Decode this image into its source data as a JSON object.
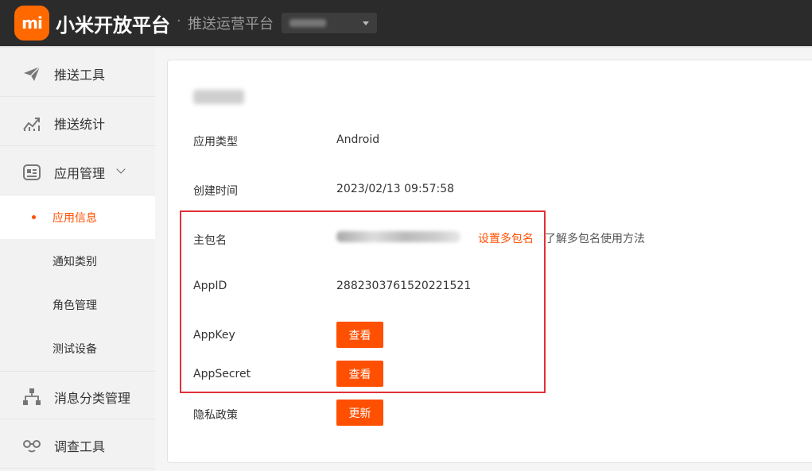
{
  "header": {
    "logo_text": "mi",
    "brand": "小米开放平台",
    "separator": "·",
    "subtitle": "推送运营平台",
    "accent_color": "#ff6900"
  },
  "sidebar": {
    "items": [
      {
        "label": "推送工具",
        "icon": "paper-plane-icon"
      },
      {
        "label": "推送统计",
        "icon": "trend-chart-icon"
      },
      {
        "label": "应用管理",
        "icon": "app-card-icon",
        "expanded": true,
        "children": [
          {
            "label": "应用信息",
            "active": true
          },
          {
            "label": "通知类别"
          },
          {
            "label": "角色管理"
          },
          {
            "label": "测试设备"
          }
        ]
      },
      {
        "label": "消息分类管理",
        "icon": "hierarchy-icon"
      },
      {
        "label": "调查工具",
        "icon": "glasses-icon"
      }
    ]
  },
  "details": {
    "app_type_label": "应用类型",
    "app_type_value": "Android",
    "created_label": "创建时间",
    "created_value": "2023/02/13 09:57:58",
    "package_label": "主包名",
    "package_link": "设置多包名",
    "package_help": "了解多包名使用方法",
    "appid_label": "AppID",
    "appid_value": "2882303761520221521",
    "appkey_label": "AppKey",
    "appkey_button": "查看",
    "appsecret_label": "AppSecret",
    "appsecret_button": "查看",
    "privacy_label": "隐私政策",
    "privacy_button": "更新"
  }
}
